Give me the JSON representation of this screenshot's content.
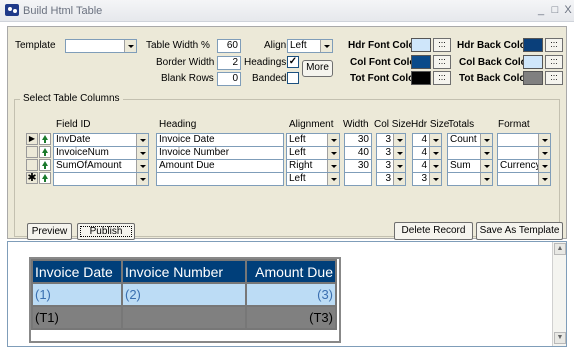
{
  "window": {
    "title": "Build Html Table",
    "minimize": "_",
    "maximize": "□",
    "close": "X"
  },
  "options": {
    "template_label": "Template",
    "template_value": "",
    "table_width_label": "Table Width %",
    "table_width_value": "60",
    "border_width_label": "Border Width",
    "border_width_value": "2",
    "blank_rows_label": "Blank Rows",
    "blank_rows_value": "0",
    "align_label": "Align",
    "align_value": "Left",
    "headings_label": "Headings",
    "headings_checked": "✓",
    "banded_label": "Banded",
    "more_label": "More",
    "hdr_font_color_label": "Hdr Font Color",
    "col_font_color_label": "Col Font Color",
    "tot_font_color_label": "Tot Font Color",
    "hdr_back_color_label": "Hdr Back Color",
    "col_back_color_label": "Col Back Color",
    "tot_back_color_label": "Tot Back Color",
    "picker_label": ":::"
  },
  "colors": {
    "hdr_font": "#cfe6fa",
    "col_font": "#0a4a8a",
    "tot_font": "#000000",
    "hdr_back": "#0a3f7a",
    "col_back": "#cfe6fa",
    "tot_back": "#808080"
  },
  "columns_group": {
    "title": "Select Table Columns",
    "headers": [
      "Field ID",
      "Heading",
      "Alignment",
      "Width",
      "Col Size",
      "Hdr Size",
      "Totals",
      "Format"
    ],
    "rows": [
      {
        "field": "InvDate",
        "heading": "Invoice Date",
        "align": "Left",
        "width": "30",
        "col_size": "3",
        "hdr_size": "4",
        "totals": "Count",
        "format": ""
      },
      {
        "field": "InvoiceNum",
        "heading": "Invoice Number",
        "align": "Left",
        "width": "40",
        "col_size": "3",
        "hdr_size": "4",
        "totals": "",
        "format": ""
      },
      {
        "field": "SumOfAmount",
        "heading": "Amount Due",
        "align": "Right",
        "width": "30",
        "col_size": "3",
        "hdr_size": "4",
        "totals": "Sum",
        "format": "Currency"
      },
      {
        "field": "",
        "heading": "",
        "align": "Left",
        "width": "",
        "col_size": "3",
        "hdr_size": "3",
        "totals": "",
        "format": ""
      }
    ]
  },
  "actions": {
    "preview": "Preview",
    "publish": "Publish",
    "delete_record": "Delete Record",
    "save_as_template": "Save As Template"
  },
  "preview_table": {
    "headers": [
      "Invoice Date",
      "Invoice Number",
      "Amount Due"
    ],
    "row": [
      "(1)",
      "(2)",
      "(3)"
    ],
    "totals": [
      "(T1)",
      "",
      "(T3)"
    ]
  }
}
